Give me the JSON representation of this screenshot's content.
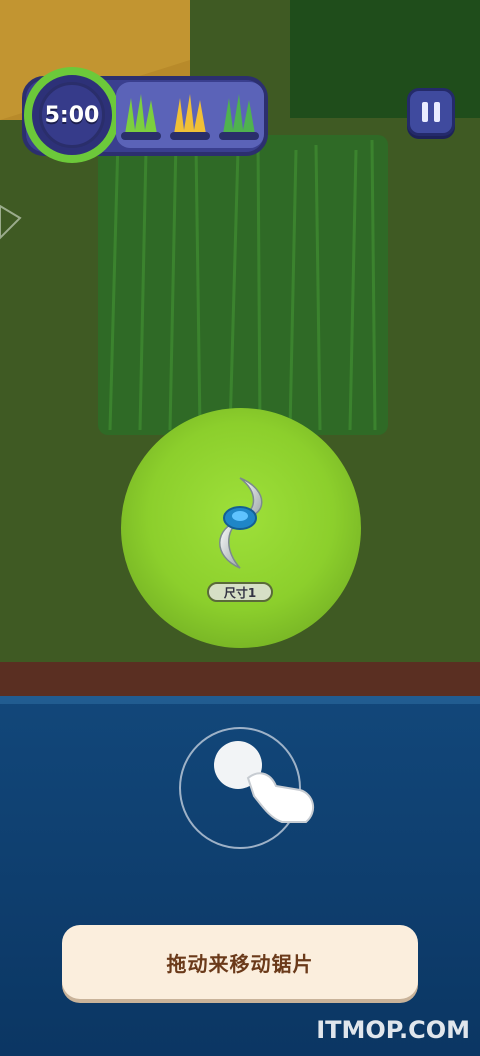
{
  "hud": {
    "timer": "5:00",
    "grass_slots": [
      {
        "color": "#7ccf3f"
      },
      {
        "color": "#f0c037"
      },
      {
        "color": "#4fb24f"
      }
    ],
    "pause_icon": "pause-icon"
  },
  "blade": {
    "size_label": "尺寸1"
  },
  "tutorial": {
    "hint_text": "拖动来移动锯片"
  },
  "watermark": "ITMOP.COM",
  "colors": {
    "lawn": "#3f5a23",
    "tall_grass": "#2f6a26",
    "cut_circle": "#8fd12e",
    "water": "#0f3f6e",
    "hud_panel": "#3a3f8f"
  }
}
